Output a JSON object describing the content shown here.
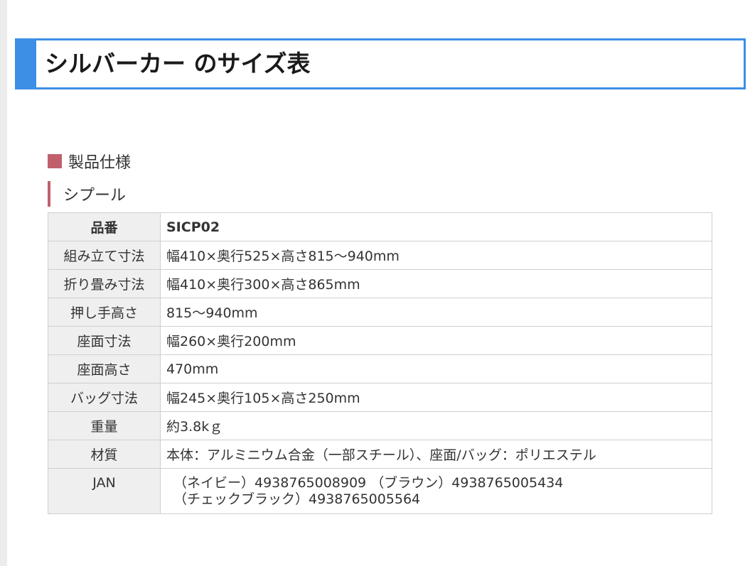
{
  "title": "シルバーカー のサイズ表",
  "section_heading": "製品仕様",
  "product_name": "シプール",
  "spec_table": {
    "header": {
      "label": "品番",
      "value": "SICP02"
    },
    "rows": [
      {
        "label": "組み立て寸法",
        "value": "幅410×奥行525×高さ815〜940mm"
      },
      {
        "label": "折り畳み寸法",
        "value": "幅410×奥行300×高さ865mm"
      },
      {
        "label": "押し手高さ",
        "value": "815〜940mm"
      },
      {
        "label": "座面寸法",
        "value": "幅260×奥行200mm"
      },
      {
        "label": "座面高さ",
        "value": "470mm"
      },
      {
        "label": "バッグ寸法",
        "value": "幅245×奥行105×高さ250mm"
      },
      {
        "label": "重量",
        "value": "約3.8kｇ"
      },
      {
        "label": "材質",
        "value": "本体：アルミニウム合金（一部スチール）、座面/バッグ：ポリエステル"
      }
    ],
    "jan": {
      "label": "JAN",
      "lines": [
        "（ネイビー）4938765008909 （ブラウン）4938765005434",
        "（チェックブラック）4938765005564"
      ]
    }
  },
  "colors": {
    "title_accent": "#3d8fe6",
    "heading_mark": "#c0606d",
    "label_cell_bg": "#efefef",
    "table_border": "#cfcfcf"
  }
}
